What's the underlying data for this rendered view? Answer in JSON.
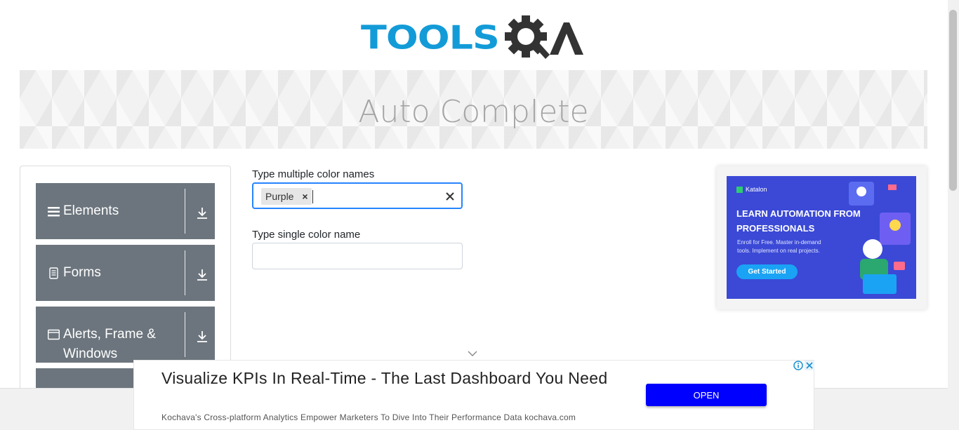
{
  "header": {
    "logo_text": "TOOLSQA"
  },
  "banner": {
    "title": "Auto Complete"
  },
  "sidebar": {
    "groups": [
      {
        "label": "Elements",
        "icon": "menu-icon"
      },
      {
        "label": "Forms",
        "icon": "document-icon"
      },
      {
        "label": "Alerts, Frame & Windows",
        "icon": "window-icon"
      },
      {
        "label": "",
        "icon": ""
      }
    ]
  },
  "form": {
    "multi": {
      "label": "Type multiple color names",
      "chips": [
        "Purple"
      ],
      "value": ""
    },
    "single": {
      "label": "Type single color name",
      "value": ""
    }
  },
  "right_ad": {
    "brand": "Katalon",
    "headline": "LEARN AUTOMATION FROM PROFESSIONALS",
    "subtext": "Enroll for Free. Master in-demand tools. Implement on real projects.",
    "cta": "Get Started",
    "colors": {
      "background": "#3b49d6",
      "cta": "#1aa3f5"
    }
  },
  "bottom_ad": {
    "headline": "Visualize KPIs In Real-Time - The Last Dashboard You Need",
    "description": "Kochava's Cross-platform Analytics Empower Marketers To Dive Into Their Performance Data kochava.com",
    "button_label": "OPEN",
    "colors": {
      "button": "#0000ff"
    }
  },
  "colors": {
    "accent": "#139bd8",
    "sidebar_group": "#6c757d",
    "focus_border": "#2684ff"
  }
}
